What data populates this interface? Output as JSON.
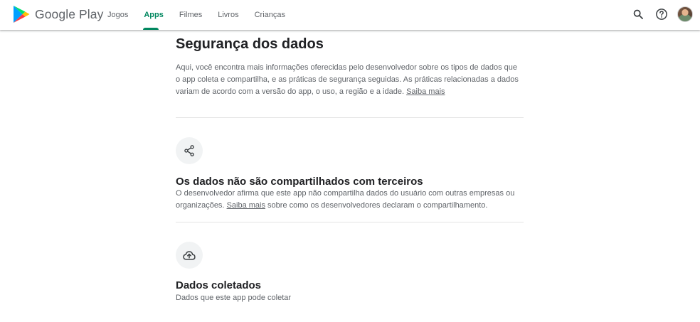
{
  "header": {
    "logo_text": "Google Play",
    "nav": [
      {
        "label": "Jogos",
        "active": false
      },
      {
        "label": "Apps",
        "active": true
      },
      {
        "label": "Filmes",
        "active": false
      },
      {
        "label": "Livros",
        "active": false
      },
      {
        "label": "Crianças",
        "active": false
      }
    ],
    "icons": [
      "search-icon",
      "help-icon",
      "account-avatar"
    ]
  },
  "colors": {
    "accent": "#01875f",
    "text_primary": "#202124",
    "text_secondary": "#5f6368",
    "icon_bg": "#f1f3f4",
    "divider": "#e3e3e3"
  },
  "page": {
    "title": "Segurança dos dados",
    "intro_text": "Aqui, você encontra mais informações oferecidas pelo desenvolvedor sobre os tipos de dados que o app coleta e compartilha, e as práticas de segurança seguidas. As práticas relacionadas a dados variam de acordo com a versão do app, o uso, a região e a idade.",
    "intro_link": "Saiba mais"
  },
  "sections": [
    {
      "icon": "share-icon",
      "title": "Os dados não são compartilhados com terceiros",
      "desc_before": "O desenvolvedor afirma que este app não compartilha dados do usuário com outras empresas ou organizações.",
      "link": "Saiba mais",
      "desc_after": "sobre como os desenvolvedores declaram o compartilhamento."
    },
    {
      "icon": "cloud-upload-icon",
      "title": "Dados coletados",
      "desc": "Dados que este app pode coletar"
    }
  ]
}
